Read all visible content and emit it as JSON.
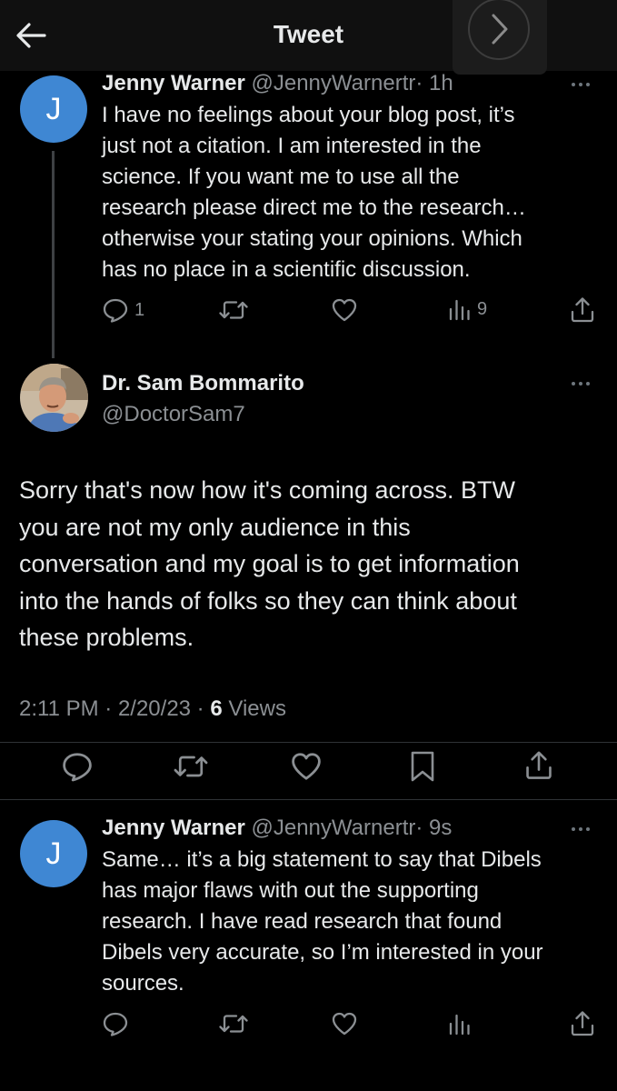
{
  "header": {
    "title": "Tweet",
    "back_icon": "arrow-left-icon",
    "forward_icon": "chevron-right-icon"
  },
  "reply1": {
    "avatar_letter": "J",
    "avatar_color": "#3f87d3",
    "name": "Jenny Warner",
    "handle": "@JennyWarnertr",
    "time": "· 1h",
    "lines": [
      "I have no feelings about your blog post, it’s",
      "just not a citation. I am interested in the",
      "science. If you want me to use all the",
      "research please direct me to the research…",
      "otherwise your stating your opinions.  Which",
      "has no place in a scientific discussion."
    ],
    "reply_count": "1",
    "views": "9"
  },
  "main": {
    "name": "Dr. Sam Bommarito",
    "handle": "@DoctorSam7",
    "lines": [
      "Sorry that's now how it's coming across. BTW",
      "you are not my only audience in this",
      "conversation and my goal is to get information",
      "into the hands of folks so they can think about",
      "these problems."
    ],
    "time": "2:11 PM",
    "date": "2/20/23",
    "views_count": "6",
    "views_label": "Views"
  },
  "reply2": {
    "avatar_letter": "J",
    "name": "Jenny Warner",
    "handle": "@JennyWarnertr",
    "time": "· 9s",
    "lines": [
      "Same… it’s a big statement to say that Dibels",
      "has major flaws with out the supporting",
      "research.  I have read research that found",
      "Dibels very accurate, so I’m interested in your",
      "sources."
    ]
  },
  "colors": {
    "background": "#000000",
    "text": "#e7e9ea",
    "muted": "#8b8f93",
    "accent": "#3f87d3"
  }
}
